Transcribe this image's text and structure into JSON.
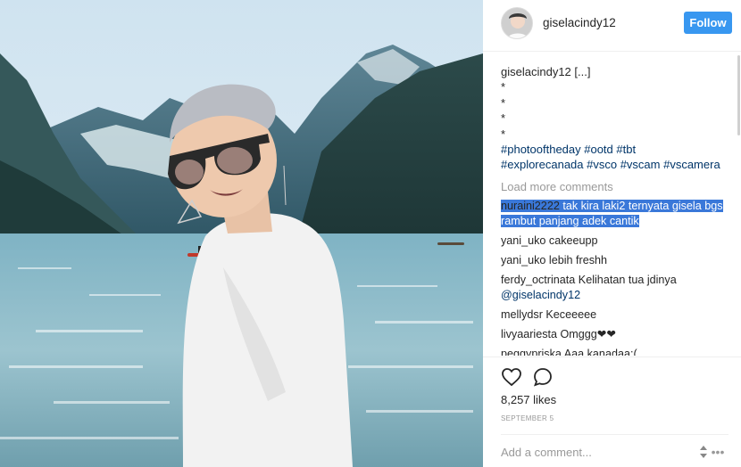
{
  "post": {
    "username": "giselacindy12",
    "follow_label": "Follow",
    "caption_user": "giselacindy12",
    "caption_text": " [...]",
    "caption_dots": [
      "*",
      "*",
      "*",
      "*"
    ],
    "hashtags_line1": "#photooftheday #ootd #tbt",
    "hashtags_line2": "#explorecanada #vsco #vscam #vscamera",
    "load_more_label": "Load more comments",
    "comments": [
      {
        "user": "nuraini2222",
        "text": " tak kira laki2 ternyata gisela bgs rambut panjang adek cantik"
      },
      {
        "user": "yani_uko",
        "text": " cakeeupp"
      },
      {
        "user": "yani_uko",
        "text": " lebih freshh"
      },
      {
        "user": "ferdy_octrinata",
        "text": " Kelihatan tua jdinya",
        "mention": "@giselacindy12"
      },
      {
        "user": "mellydsr",
        "text": " Keceeeee"
      },
      {
        "user": "livyaariesta",
        "text": " Omggg❤❤"
      },
      {
        "user": "peggypriska",
        "text": " Aaa kanadaa:("
      }
    ],
    "likes": "8,257 likes",
    "date": "SEPTEMBER 5",
    "comment_placeholder": "Add a comment...",
    "more_icon": "ellipsis-icon",
    "like_icon": "heart-icon",
    "comment_icon": "speech-bubble-icon"
  },
  "colors": {
    "follow_bg": "#3897f0",
    "hashtag": "#003569",
    "highlight": "#3a78d9",
    "muted": "#999999"
  }
}
